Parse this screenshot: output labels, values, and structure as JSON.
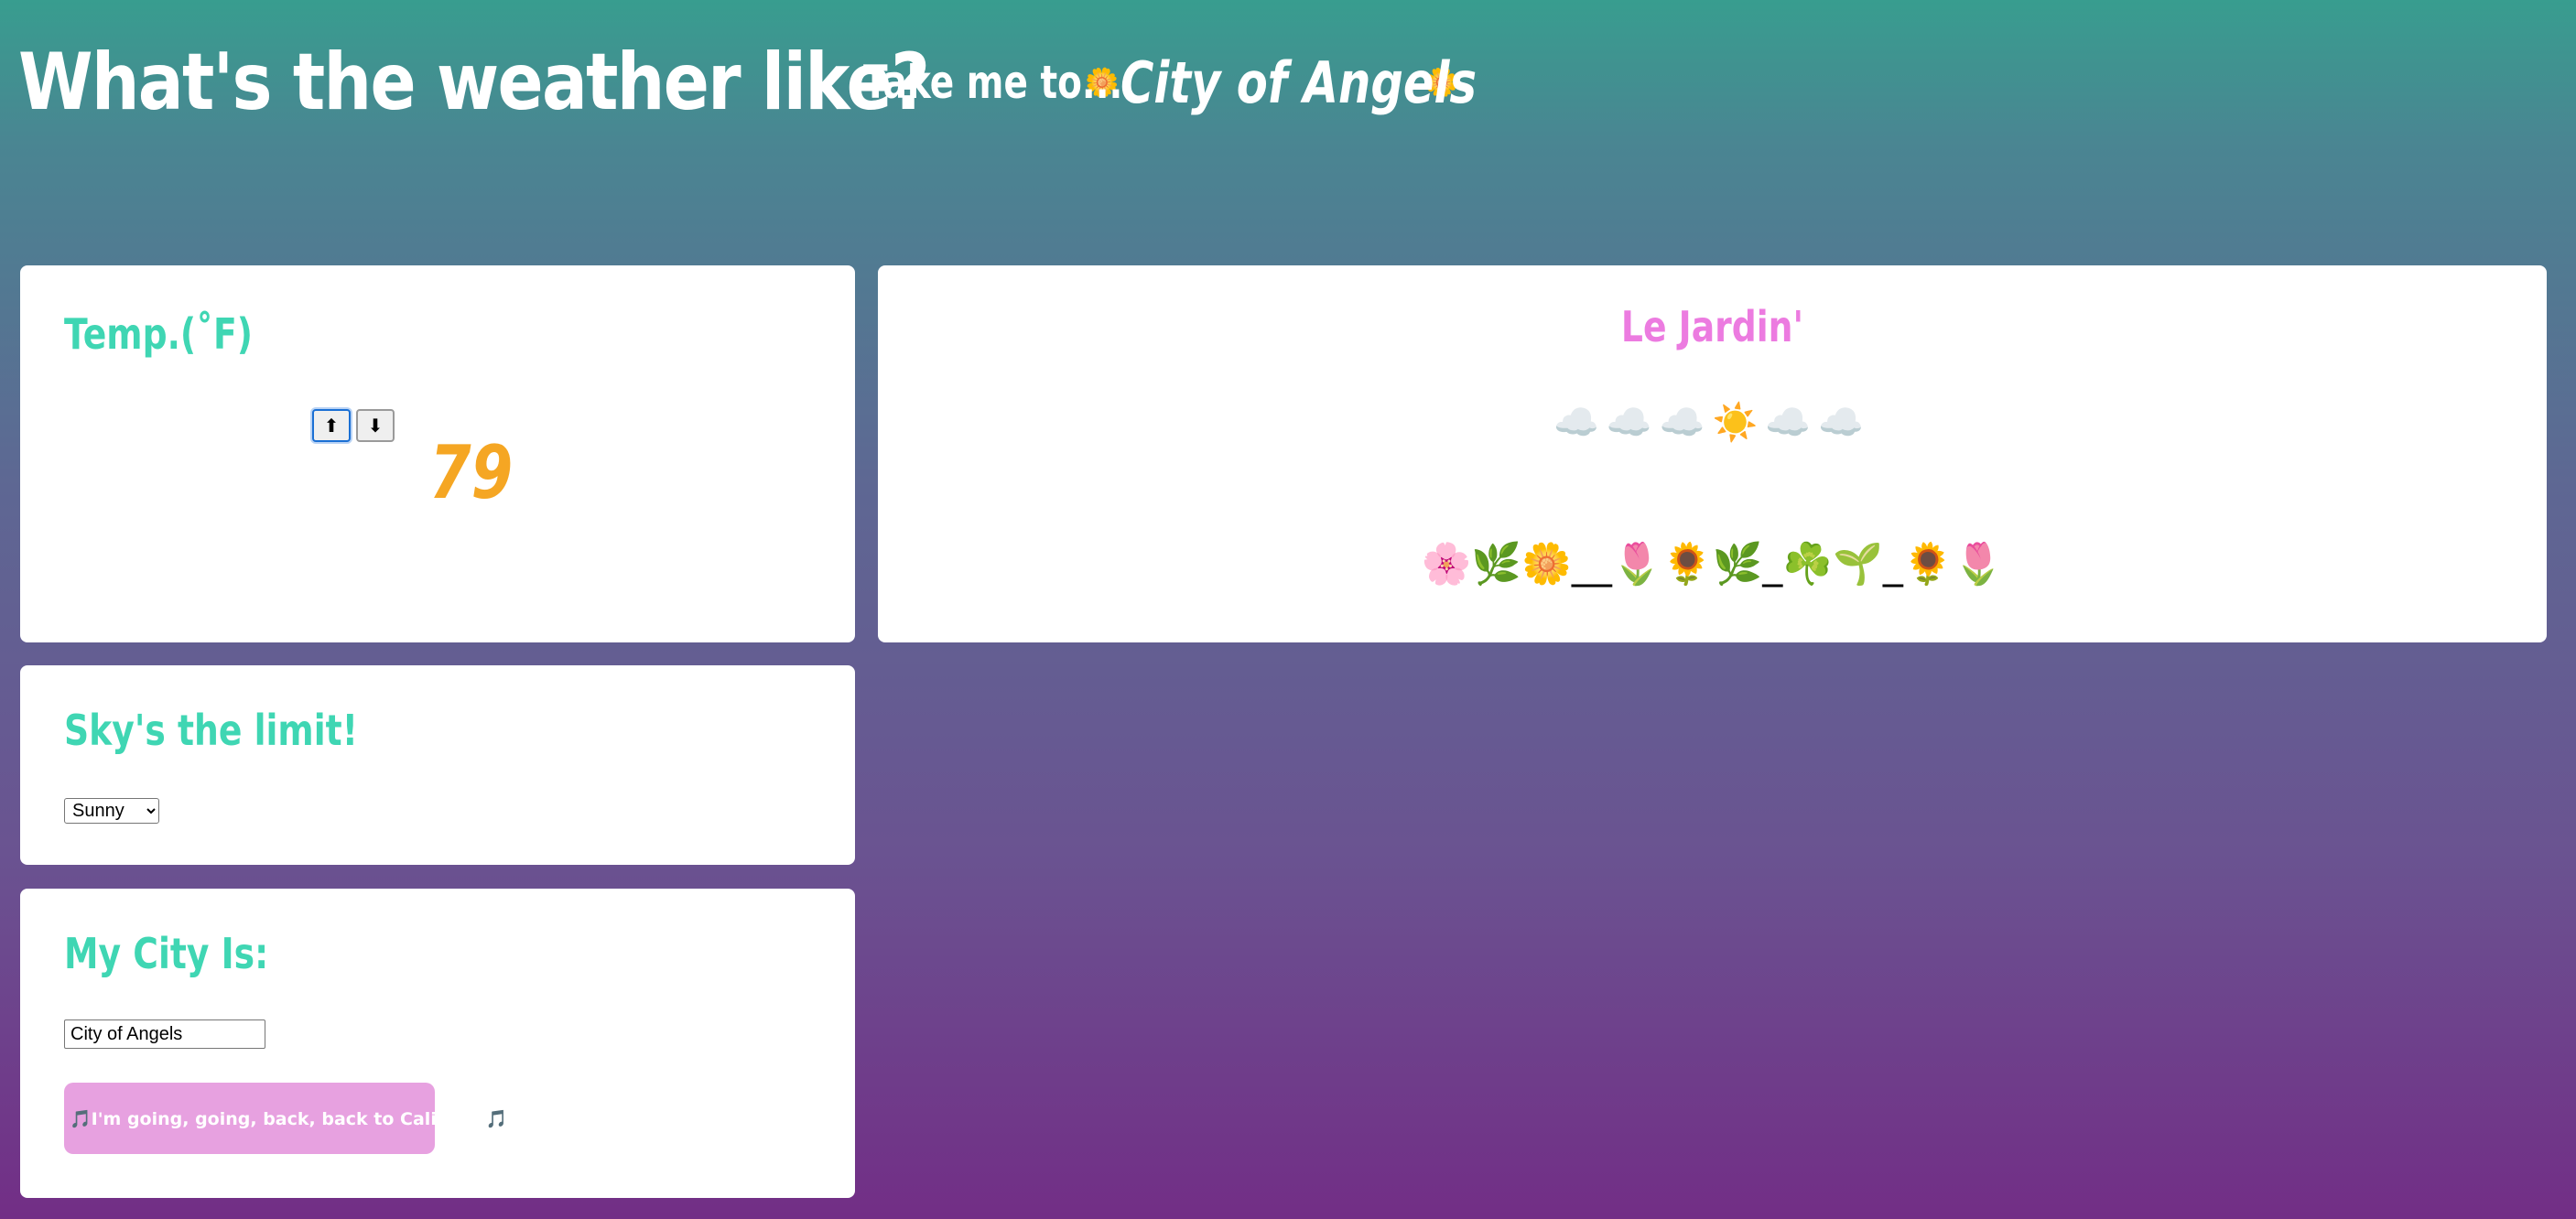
{
  "header": {
    "title": "What's the weather like?",
    "take_me_label": "Take me to...",
    "city_name": "City of Angels",
    "flower_icon": "🌼"
  },
  "temp_card": {
    "title": "Temp.(˚F)",
    "up_icon": "⬆",
    "down_icon": "⬇",
    "value": "79"
  },
  "garden_card": {
    "title": "Le Jardin'",
    "sky_row": "☁️☁️☁️☀️☁️☁️",
    "flower_row": "🌸🌿🌼__🌷🌻🌿_☘️🌱_🌻🌷"
  },
  "sky_card": {
    "title": "Sky's the limit!",
    "selected": "Sunny"
  },
  "city_card": {
    "title": "My City Is:",
    "input_value": "City of Angels",
    "button_label": "🎵I'm going, going, back, back to Cali, Cali🎵"
  },
  "colors": {
    "card_title": "#3fd6b3",
    "garden_title": "#ec7be0",
    "temp_value": "#f5a623",
    "song_button": "#e7a1e0"
  }
}
